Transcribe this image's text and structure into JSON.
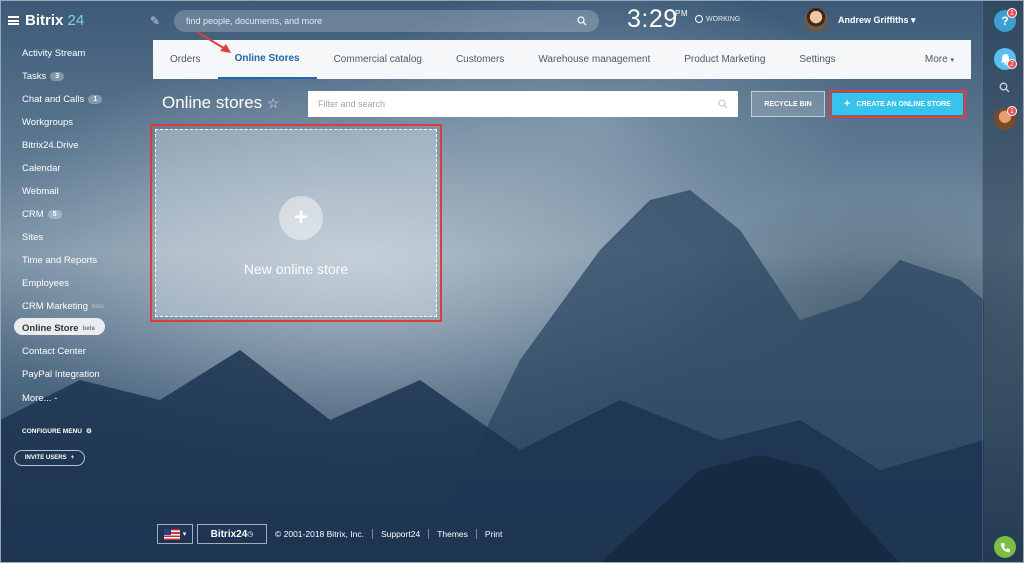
{
  "header": {
    "logo_main": "Bitrix",
    "logo_accent": "24",
    "search_placeholder": "find people, documents, and more",
    "clock_time": "3:29",
    "clock_ampm": "PM",
    "status": "WORKING",
    "user_name": "Andrew Griffiths"
  },
  "sidebar": {
    "items": [
      {
        "label": "Activity Stream",
        "count": ""
      },
      {
        "label": "Tasks",
        "count": "3"
      },
      {
        "label": "Chat and Calls",
        "count": "1"
      },
      {
        "label": "Workgroups",
        "count": ""
      },
      {
        "label": "Bitrix24.Drive",
        "count": ""
      },
      {
        "label": "Calendar",
        "count": ""
      },
      {
        "label": "Webmail",
        "count": ""
      },
      {
        "label": "CRM",
        "count": "5"
      },
      {
        "label": "Sites",
        "count": ""
      },
      {
        "label": "Time and Reports",
        "count": ""
      },
      {
        "label": "Employees",
        "count": ""
      },
      {
        "label": "CRM Marketing",
        "count": "",
        "sup": "beta"
      },
      {
        "label": "Online Store",
        "count": "",
        "sup": "beta"
      },
      {
        "label": "Contact Center",
        "count": ""
      },
      {
        "label": "PayPal Integration",
        "count": ""
      },
      {
        "label": "More... -",
        "count": ""
      }
    ],
    "configure_menu": "CONFIGURE MENU",
    "invite_users": "INVITE USERS"
  },
  "tabs": [
    {
      "label": "Orders"
    },
    {
      "label": "Online Stores"
    },
    {
      "label": "Commercial catalog"
    },
    {
      "label": "Customers"
    },
    {
      "label": "Warehouse management"
    },
    {
      "label": "Product Marketing"
    },
    {
      "label": "Settings"
    },
    {
      "label": "More"
    }
  ],
  "page": {
    "title": "Online stores",
    "filter_placeholder": "Filter and search",
    "recycle_bin": "RECYCLE BIN",
    "create_store": "CREATE AN ONLINE STORE",
    "new_store_label": "New online store"
  },
  "rail": {
    "help_badge": "1",
    "notif_badge": "2",
    "avatar_badge": "1"
  },
  "footer": {
    "brand": "Bitrix24",
    "copyright": "© 2001-2018 Bitrix, Inc.",
    "support": "Support24",
    "themes": "Themes",
    "print": "Print"
  },
  "colors": {
    "accent": "#36c4ee",
    "active_tab": "#2067b0",
    "highlight_border": "#e03b3b"
  }
}
